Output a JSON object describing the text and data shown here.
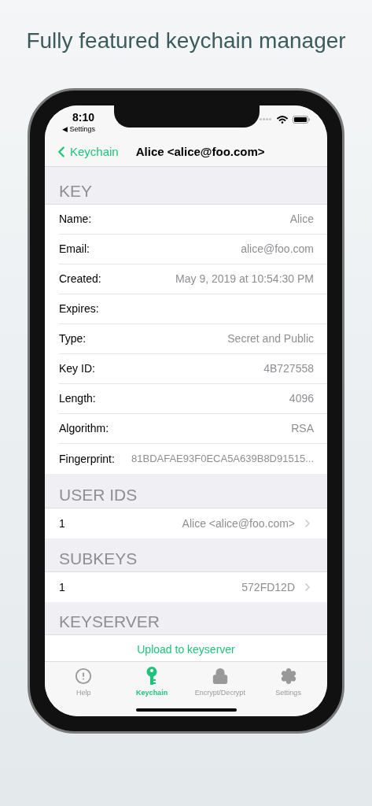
{
  "headline": "Fully featured keychain manager",
  "status_bar": {
    "time": "8:10",
    "back_app": "◀ Settings"
  },
  "nav": {
    "back": "Keychain",
    "title": "Alice <alice@foo.com>"
  },
  "sections": [
    {
      "header": "KEY",
      "rows": [
        {
          "kind": "field",
          "label": "Name:",
          "value": "Alice"
        },
        {
          "kind": "field",
          "label": "Email:",
          "value": "alice@foo.com"
        },
        {
          "kind": "field",
          "label": "Created:",
          "value": "May 9, 2019 at 10:54:30 PM"
        },
        {
          "kind": "field",
          "label": "Expires:"
        },
        {
          "kind": "field",
          "label": "Type:",
          "value": "Secret and Public"
        },
        {
          "kind": "field",
          "label": "Key ID:",
          "value": "4B727558"
        },
        {
          "kind": "field",
          "label": "Length:",
          "value": "4096"
        },
        {
          "kind": "field",
          "label": "Algorithm:",
          "value": "RSA"
        },
        {
          "kind": "field",
          "label": "Fingerprint:",
          "value": "81BDAFAE93F0ECA5A639B8D91515..."
        }
      ]
    },
    {
      "header": "USER IDS",
      "rows": [
        {
          "kind": "link",
          "label": "1",
          "value": "Alice <alice@foo.com>"
        }
      ]
    },
    {
      "header": "SUBKEYS",
      "rows": [
        {
          "kind": "link",
          "label": "1",
          "value": "572FD12D"
        }
      ]
    },
    {
      "header": "KEYSERVER",
      "rows": [
        {
          "kind": "action",
          "label": "Upload to keyserver"
        }
      ]
    }
  ],
  "tabs": [
    {
      "kind": "help",
      "label": "Help",
      "selected": false
    },
    {
      "kind": "keychain",
      "label": "Keychain",
      "selected": true
    },
    {
      "kind": "lock",
      "label": "Encrypt/Decrypt",
      "selected": false
    },
    {
      "kind": "settings",
      "label": "Settings",
      "selected": false
    }
  ]
}
